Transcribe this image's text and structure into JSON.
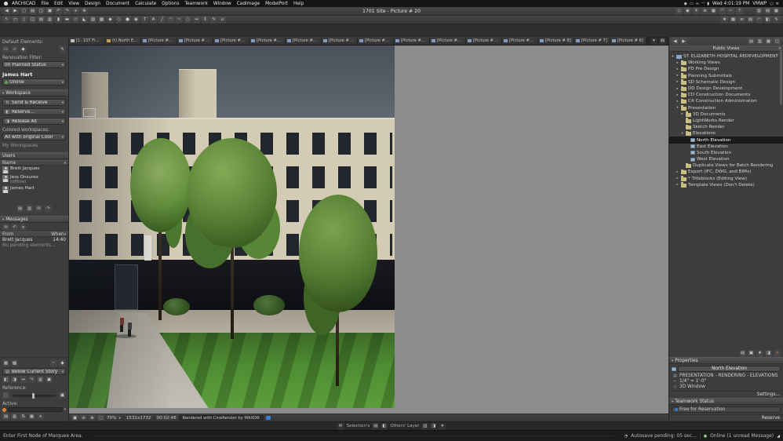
{
  "menubar": {
    "items": [
      "ARCHICAD",
      "File",
      "Edit",
      "View",
      "Design",
      "Document",
      "Calculate",
      "Options",
      "Teamwork",
      "Window",
      "Cadimage",
      "ModelPort",
      "Help"
    ],
    "status_icons": [
      {
        "name": "screen-recording-icon",
        "glyph": "◉"
      },
      {
        "name": "display-icon",
        "glyph": "▭"
      },
      {
        "name": "sound-icon",
        "glyph": "≈"
      },
      {
        "name": "wifi-icon",
        "glyph": "◠"
      },
      {
        "name": "battery-icon",
        "glyph": "▮"
      }
    ],
    "time": "Wed 4:01:19 PM",
    "user": "VMWP",
    "right_icons": [
      {
        "name": "spotlight-search-icon",
        "glyph": "○"
      },
      {
        "name": "notification-center-icon",
        "glyph": "≡"
      }
    ]
  },
  "window": {
    "title": "1701 Site - Picture # 20"
  },
  "toolbar1": {
    "left_icons": [
      {
        "name": "go-back-icon",
        "glyph": "◀"
      },
      {
        "name": "go-forward-icon",
        "glyph": "▶"
      },
      {
        "name": "new-project-icon",
        "glyph": "▢"
      },
      {
        "name": "open-project-icon",
        "glyph": "▤"
      },
      {
        "name": "save-icon",
        "glyph": "◫"
      },
      {
        "name": "print-icon",
        "glyph": "▣"
      },
      {
        "name": "undo-icon",
        "glyph": "↶"
      },
      {
        "name": "redo-icon",
        "glyph": "↷"
      },
      {
        "name": "pan-icon",
        "glyph": "+"
      },
      {
        "name": "zoom-icon",
        "glyph": "⊕"
      }
    ],
    "right_icons": [
      {
        "name": "3d-view-icon",
        "glyph": "◇"
      },
      {
        "name": "camera-icon",
        "glyph": "◉"
      },
      {
        "name": "sun-study-icon",
        "glyph": "☀"
      },
      {
        "name": "layers-icon",
        "glyph": "≡"
      },
      {
        "name": "grid-snap-icon",
        "glyph": "▦"
      },
      {
        "name": "gravity-icon",
        "glyph": "◠"
      },
      {
        "name": "ruler-icon",
        "glyph": "⌐"
      },
      {
        "name": "help-icon",
        "glyph": "?"
      }
    ],
    "corner_icons": [
      {
        "name": "organize-palettes-icon",
        "glyph": "▥"
      },
      {
        "name": "window-arrange-icon",
        "glyph": "▤"
      },
      {
        "name": "teamwork-palette-icon",
        "glyph": "▦"
      }
    ]
  },
  "toolbar2": {
    "icons": [
      {
        "name": "arrow-tool",
        "glyph": "↖"
      },
      {
        "name": "marquee-tool",
        "glyph": "▭"
      },
      {
        "name": "wall-tool",
        "glyph": "▯"
      },
      {
        "name": "door-tool",
        "glyph": "◫"
      },
      {
        "name": "window-tool",
        "glyph": "▤"
      },
      {
        "name": "curtain-wall-tool",
        "glyph": "▥"
      },
      {
        "name": "column-tool",
        "glyph": "▮"
      },
      {
        "name": "beam-tool",
        "glyph": "▬"
      },
      {
        "name": "slab-tool",
        "glyph": "▱"
      },
      {
        "name": "roof-tool",
        "glyph": "◣"
      },
      {
        "name": "shell-tool",
        "glyph": "▨"
      },
      {
        "name": "morph-tool",
        "glyph": "▩"
      },
      {
        "name": "object-tool",
        "glyph": "◆"
      },
      {
        "name": "lamp-tool",
        "glyph": "◇"
      },
      {
        "name": "zone-tool",
        "glyph": "●"
      },
      {
        "name": "stair-tool",
        "glyph": "◉"
      },
      {
        "name": "text-tool",
        "glyph": "T"
      },
      {
        "name": "label-tool",
        "glyph": "A"
      },
      {
        "name": "line-tool",
        "glyph": "╱"
      },
      {
        "name": "arc-tool",
        "glyph": "◠"
      },
      {
        "name": "spline-tool",
        "glyph": "~"
      },
      {
        "name": "hotspot-tool",
        "glyph": "○"
      },
      {
        "name": "dimension-tool",
        "glyph": "↔"
      },
      {
        "name": "section-tool",
        "glyph": "↕"
      },
      {
        "name": "detail-tool",
        "glyph": "✎"
      },
      {
        "name": "camera-tool",
        "glyph": "⌂"
      }
    ],
    "right_icons": [
      {
        "name": "favorites-icon",
        "glyph": "★"
      },
      {
        "name": "layer-settings-icon",
        "glyph": "▦"
      },
      {
        "name": "quick-layers-icon",
        "glyph": "≡"
      },
      {
        "name": "story-settings-icon",
        "glyph": "▤"
      },
      {
        "name": "scale-icon",
        "glyph": "⌐"
      },
      {
        "name": "trace-reference-icon",
        "glyph": "◧"
      },
      {
        "name": "edit-elements-icon",
        "glyph": "✎"
      }
    ]
  },
  "tabbar": {
    "tabs": [
      {
        "label": "[1: 1ST Fl...",
        "icon": "plan"
      },
      {
        "label": "(t) North E...",
        "icon": "elevation"
      },
      {
        "label": "[Picture #...",
        "icon": "picture"
      },
      {
        "label": "[Picture #...",
        "icon": "picture"
      },
      {
        "label": "[Picture #...",
        "icon": "picture"
      },
      {
        "label": "[Picture #...",
        "icon": "picture"
      },
      {
        "label": "[Picture #...",
        "icon": "picture"
      },
      {
        "label": "[Picture #...",
        "icon": "picture"
      },
      {
        "label": "[Picture #...",
        "icon": "picture"
      },
      {
        "label": "[Picture #...",
        "icon": "picture"
      },
      {
        "label": "[Picture #...",
        "icon": "picture"
      },
      {
        "label": "[Picture #...",
        "icon": "picture"
      },
      {
        "label": "[Picture #...",
        "icon": "picture"
      },
      {
        "label": "[Picture # 8]",
        "icon": "picture"
      },
      {
        "label": "[Picture # 7]",
        "icon": "picture"
      },
      {
        "label": "[Picture # 6]",
        "icon": "picture"
      }
    ],
    "controls": [
      {
        "name": "tab-list-icon",
        "glyph": "▾"
      },
      {
        "name": "tab-options-icon",
        "glyph": "▤"
      }
    ]
  },
  "left_panel": {
    "default_elements": {
      "label": "Default Elements:",
      "icons": [
        {
          "name": "default-wall-icon",
          "glyph": "▭"
        },
        {
          "name": "default-slab-icon",
          "glyph": "▱"
        },
        {
          "name": "default-object-icon",
          "glyph": "◆"
        }
      ],
      "pick_icon": {
        "name": "eyedropper-icon",
        "glyph": "✎"
      }
    },
    "renovation": {
      "label": "Renovation Filter:",
      "value": "00 Planned Status"
    },
    "user": {
      "name": "James Hart",
      "presence": "Online"
    },
    "workspace": {
      "title": "Workspace",
      "actions": [
        {
          "name": "send-receive-button",
          "glyph": "⇅",
          "label": "Send & Receive"
        },
        {
          "name": "reserve-button",
          "glyph": "◧",
          "label": "Reserve..."
        },
        {
          "name": "release-all-button",
          "glyph": "◨",
          "label": "Release All"
        }
      ],
      "colored_label": "Colored workspaces:",
      "colored_value": "All with original Color",
      "my_workspaces": "My Workspaces"
    },
    "users": {
      "title": "Users",
      "name_header": "Name",
      "items": [
        {
          "name": "Brett Jacques"
        },
        {
          "name": "Jess Onsurez",
          "note": "(offline)"
        },
        {
          "name": "James Hart"
        }
      ]
    },
    "mini_icons": [
      {
        "name": "user-filter-icon",
        "glyph": "▤"
      },
      {
        "name": "user-sort-icon",
        "glyph": "▥"
      },
      {
        "name": "user-message-icon",
        "glyph": "✉"
      },
      {
        "name": "user-refresh-icon",
        "glyph": "↷"
      }
    ],
    "messages": {
      "title": "Messages",
      "toolbar": [
        {
          "name": "new-message-icon",
          "glyph": "✉"
        },
        {
          "name": "reply-message-icon",
          "glyph": "↶"
        },
        {
          "name": "delete-message-icon",
          "glyph": "×"
        }
      ],
      "from_header": "From",
      "when_header": "When",
      "rows": [
        {
          "from": "Brett Jacques",
          "when": "14:40"
        }
      ],
      "note": "No pending elements..."
    },
    "bottom": {
      "corner_icons": [
        {
          "name": "pet-palette-icon",
          "glyph": "▦"
        },
        {
          "name": "control-box-icon",
          "glyph": "▩"
        }
      ],
      "corner_icons2": [
        {
          "name": "coordinates-icon",
          "glyph": "⌐"
        },
        {
          "name": "tracker-icon",
          "glyph": "◆"
        }
      ],
      "story_row": {
        "icon": {
          "name": "trace-story-icon",
          "glyph": "▤"
        },
        "label": "Below Current Story"
      },
      "toggle_icons": [
        {
          "name": "trace-on-icon",
          "glyph": "◧"
        },
        {
          "name": "trace-switch-icon",
          "glyph": "◨"
        },
        {
          "name": "trace-move-icon",
          "glyph": "↔"
        },
        {
          "name": "trace-rotate-icon",
          "glyph": "↷"
        },
        {
          "name": "trace-splitter-icon",
          "glyph": "▥"
        },
        {
          "name": "trace-settings-icon",
          "glyph": "▣"
        }
      ],
      "reference_label": "Reference:",
      "slider_icons": [
        {
          "name": "reference-less-icon",
          "glyph": "▢"
        },
        {
          "name": "reference-more-icon",
          "glyph": "▣"
        }
      ],
      "active_label": "Active:",
      "bottom_icons": [
        {
          "name": "visibility-icon",
          "glyph": "▤"
        },
        {
          "name": "ghost-icon",
          "glyph": "▥"
        },
        {
          "name": "switch-reference-icon",
          "glyph": "⇅"
        },
        {
          "name": "fill-toggle-icon",
          "glyph": "▦"
        },
        {
          "name": "close-trace-icon",
          "glyph": "×"
        }
      ]
    }
  },
  "viewport": {
    "bar": {
      "icons": [
        {
          "name": "zoom-menu-icon",
          "glyph": "▣"
        },
        {
          "name": "zoom-out-icon",
          "glyph": "⊖"
        },
        {
          "name": "zoom-in-icon",
          "glyph": "⊕"
        },
        {
          "name": "fit-in-window-icon",
          "glyph": "▢"
        }
      ],
      "zoom": "70%",
      "resolution": "1532x1732",
      "elapsed": "00:02:46",
      "render_note": "Rendered with CineRender by MAXON"
    }
  },
  "right_panel": {
    "nav_left_icons": [
      {
        "name": "navigator-back-icon",
        "glyph": "◀"
      },
      {
        "name": "navigator-forward-icon",
        "glyph": "▶"
      }
    ],
    "nav_right_icons": [
      {
        "name": "project-map-icon",
        "glyph": "▤"
      },
      {
        "name": "view-map-icon",
        "glyph": "▥"
      },
      {
        "name": "layout-book-icon",
        "glyph": "▦"
      },
      {
        "name": "publisher-sets-icon",
        "glyph": "◫"
      }
    ],
    "title": "Public Views",
    "close_glyph": "×",
    "tree": [
      {
        "label": "ST. ELIZABETH HOSPITAL REDEVELOPMENT",
        "level": 0,
        "arrow": "expanded",
        "icon": "project",
        "name": "tree-item-root"
      },
      {
        "label": "Working Views",
        "level": 1,
        "arrow": "collapsed",
        "icon": "folder"
      },
      {
        "label": "PD Pre Design",
        "level": 1,
        "arrow": "collapsed",
        "icon": "folder"
      },
      {
        "label": "Planning Submittals",
        "level": 1,
        "arrow": "collapsed",
        "icon": "folder"
      },
      {
        "label": "SD Schematic Design",
        "level": 1,
        "arrow": "collapsed",
        "icon": "folder"
      },
      {
        "label": "DD Design Development",
        "level": 1,
        "arrow": "collapsed",
        "icon": "folder"
      },
      {
        "label": "CD Construction Documents",
        "level": 1,
        "arrow": "collapsed",
        "icon": "folder"
      },
      {
        "label": "CA Construction Administration",
        "level": 1,
        "arrow": "collapsed",
        "icon": "folder"
      },
      {
        "label": "Presentation",
        "level": 1,
        "arrow": "expanded",
        "icon": "folder"
      },
      {
        "label": "3D Documents",
        "level": 2,
        "arrow": "collapsed",
        "icon": "folder"
      },
      {
        "label": "LightWorks Render",
        "level": 2,
        "icon": "folder"
      },
      {
        "label": "Sketch Render",
        "level": 2,
        "icon": "folder"
      },
      {
        "label": "Elevations",
        "level": 2,
        "arrow": "expanded",
        "icon": "folder"
      },
      {
        "label": "North Elevation",
        "level": 3,
        "icon": "view",
        "selected": true
      },
      {
        "label": "East Elevation",
        "level": 3,
        "icon": "view"
      },
      {
        "label": "South Elevation",
        "level": 3,
        "icon": "view"
      },
      {
        "label": "West Elevation",
        "level": 3,
        "icon": "view"
      },
      {
        "label": "Duplicate Views for Batch Rendering",
        "level": 2,
        "icon": "folder"
      },
      {
        "label": "Export (IFC, DWG, and BIMx)",
        "level": 1,
        "arrow": "collapsed",
        "icon": "folder"
      },
      {
        "label": "* Titleblocks (Editing View)",
        "level": 1,
        "arrow": "collapsed",
        "icon": "folder"
      },
      {
        "label": "Template Views (Don't Delete)",
        "level": 1,
        "arrow": "collapsed",
        "icon": "folder"
      }
    ],
    "preview_icons": [
      {
        "name": "preview-panel-icon",
        "glyph": "▤"
      },
      {
        "name": "zoom-preview-icon",
        "glyph": "▣"
      },
      {
        "name": "pin-navigator-icon",
        "glyph": "★"
      },
      {
        "name": "dock-navigator-icon",
        "glyph": "◨"
      }
    ],
    "close_preview": {
      "name": "close-navigator-icon",
      "glyph": "×"
    },
    "properties": {
      "title": "Properties",
      "name": "North Elevation",
      "rows": [
        {
          "name": "view-folder-path",
          "glyph": "▤",
          "text": "PRESENTATION - RENDERING - ELEVATIONS"
        },
        {
          "name": "view-scale",
          "glyph": "⌐",
          "text": "1/4\" = 1'-0\""
        },
        {
          "name": "view-window",
          "glyph": "◇",
          "text": "3D Window"
        }
      ],
      "settings_label": "Settings..."
    },
    "teamwork": {
      "title": "Teamwork Status",
      "status": "Free for Reservation",
      "action": "Reserve"
    }
  },
  "subbar": {
    "icons_left": [
      {
        "name": "send-message-icon",
        "glyph": "✉"
      }
    ],
    "selection_label": "Selection's",
    "icons_mid": [
      {
        "name": "selection-layer-icon",
        "glyph": "▤"
      },
      {
        "name": "selection-lock-icon",
        "glyph": "◧"
      }
    ],
    "others_label": "Others' Layer",
    "icons_right": [
      {
        "name": "others-show-icon",
        "glyph": "▥"
      },
      {
        "name": "others-lock-icon",
        "glyph": "◨"
      },
      {
        "name": "layer-options-icon",
        "glyph": "▾"
      }
    ]
  },
  "statusbar": {
    "hint": "Enter First Node of Marquee Area.",
    "autosave": "Autosave pending: 05 sec...",
    "online": "Online (1 unread Message)"
  }
}
